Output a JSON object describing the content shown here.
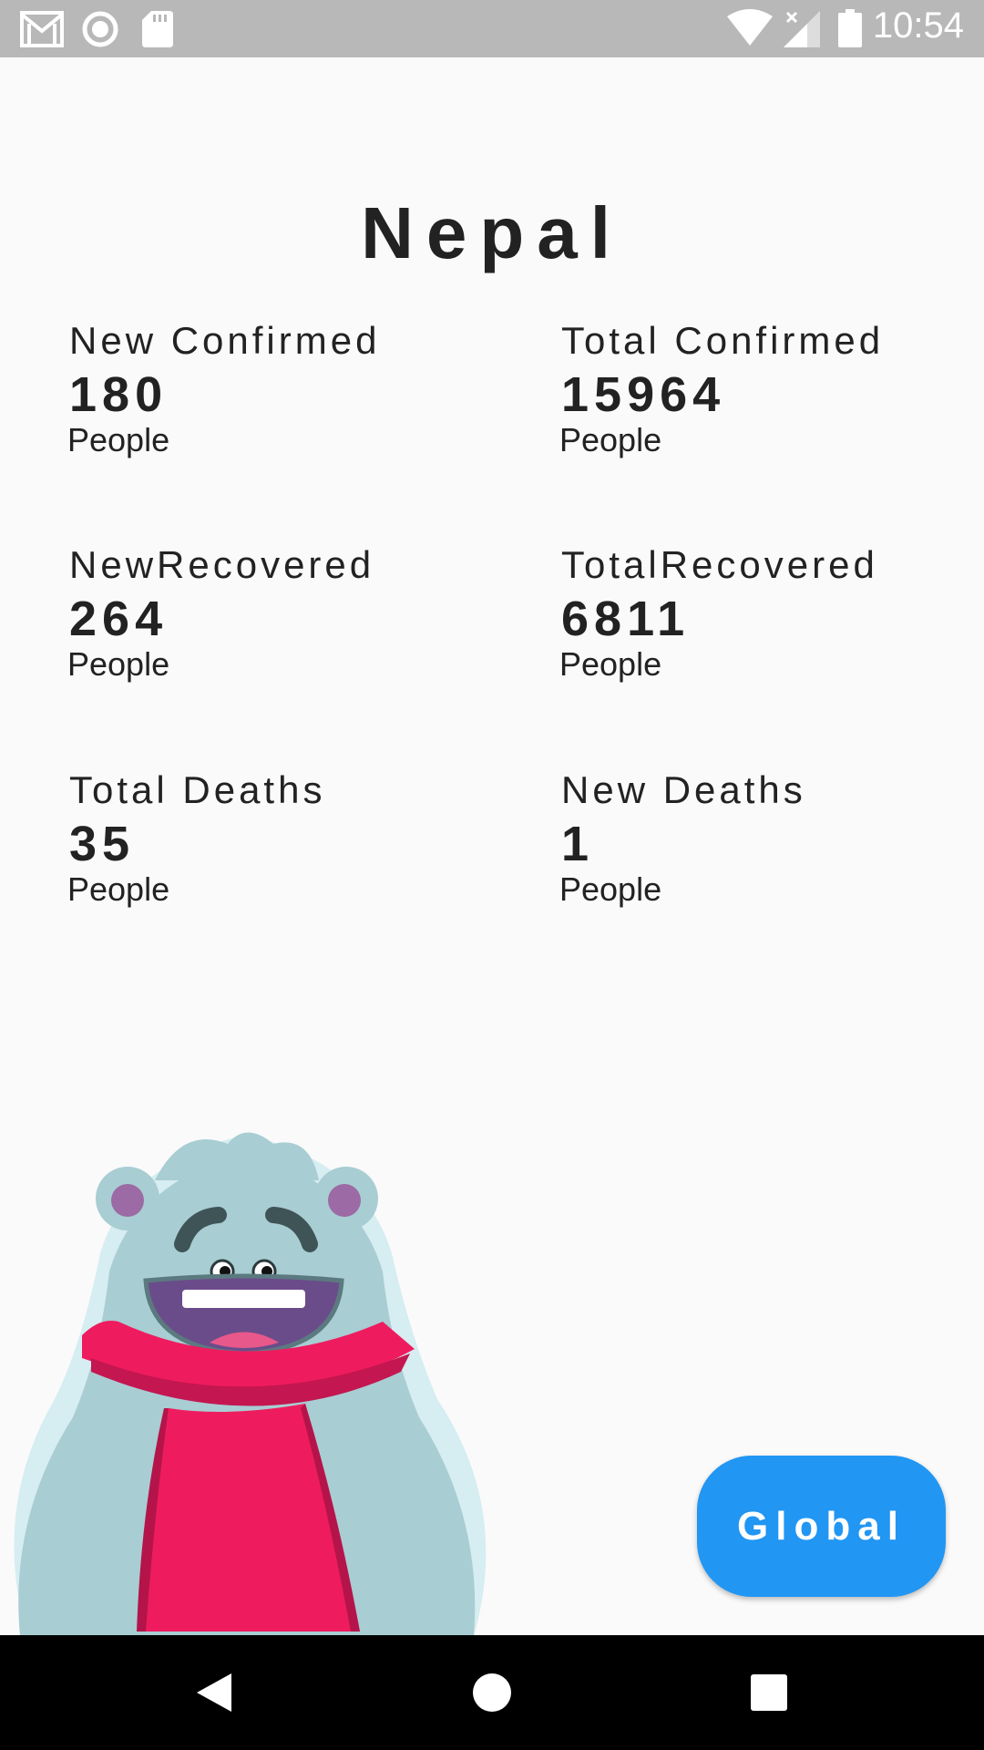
{
  "status_bar": {
    "time": "10:54",
    "icons": [
      "gmail-icon",
      "record-icon",
      "sd-card-icon",
      "wifi-icon",
      "signal-icon",
      "battery-icon"
    ]
  },
  "country": {
    "name": "Nepal"
  },
  "stats": [
    {
      "label": "New Confirmed",
      "value": "180",
      "unit": "People"
    },
    {
      "label": "Total Confirmed",
      "value": "15964",
      "unit": "People"
    },
    {
      "label": "NewRecovered",
      "value": "264",
      "unit": "People"
    },
    {
      "label": "TotalRecovered",
      "value": "6811",
      "unit": "People"
    },
    {
      "label": "Total Deaths",
      "value": "35",
      "unit": "People"
    },
    {
      "label": "New Deaths",
      "value": "1",
      "unit": "People"
    }
  ],
  "actions": {
    "global_label": "Global"
  },
  "nav": {
    "icons": [
      "back-icon",
      "home-icon",
      "recents-icon"
    ]
  },
  "colors": {
    "button": "#2196f3",
    "background": "#fafafa",
    "status_bar": "#b8b8b8",
    "scarf": "#ee1c5e",
    "fur": "#a8cdd3"
  }
}
